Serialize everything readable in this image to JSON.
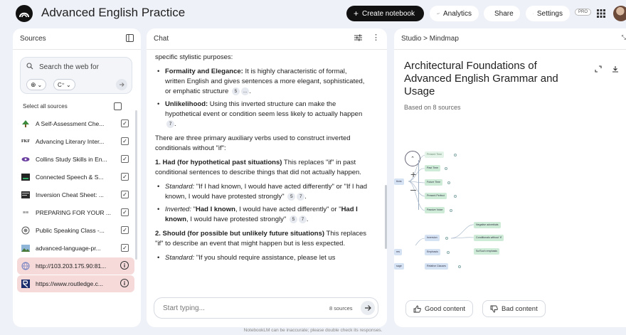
{
  "header": {
    "app_title": "Advanced English Practice",
    "create_label": "Create notebook",
    "analytics_label": "Analytics",
    "share_label": "Share",
    "settings_label": "Settings",
    "pro_label": "PRO"
  },
  "sources": {
    "title": "Sources",
    "search_placeholder": "Search the web for",
    "select_all": "Select all sources",
    "items": [
      {
        "label": "A Self-Assessment Che...",
        "checked": "✓"
      },
      {
        "label": "Advancing Literary Inter...",
        "checked": "✓"
      },
      {
        "label": "Collins Study Skills in En...",
        "checked": "✓"
      },
      {
        "label": "Connected Speech & S...",
        "checked": "✓"
      },
      {
        "label": "Inversion Cheat Sheet: ...",
        "checked": "✓"
      },
      {
        "label": "PREPARING FOR YOUR ...",
        "checked": "✓"
      },
      {
        "label": "Public Speaking Class -...",
        "checked": "✓"
      },
      {
        "label": "advanced-language-pr...",
        "checked": "✓"
      },
      {
        "label": "http://103.203.175.90:81...",
        "error": "i"
      },
      {
        "label": "https://www.routledge.c...",
        "error": "i"
      }
    ],
    "icons": {
      "p2_text": "FKF",
      "p6_text": "≡≡"
    }
  },
  "chat": {
    "title": "Chat",
    "intro_line": "specific stylistic purposes:",
    "b1_bold": "Formality and Elegance:",
    "b1_text": " It is highly characteristic of formal, written English and gives sentences a more elegant, sophisticated, or emphatic structure",
    "b1_c1": "5",
    "b1_c2": "...",
    "b1_end": ".",
    "b2_bold": "Unlikelihood:",
    "b2_text": " Using this inverted structure can make the hypothetical event or condition seem less likely to actually happen",
    "b2_c1": "7",
    "b2_end": ".",
    "p1": "There are three primary auxiliary verbs used to construct inverted conditionals without \"if\":",
    "h1_bold": "1. Had (for hypothetical past situations)",
    "h1_text": " This replaces \"if\" in past conditional sentences to describe things that did not actually happen.",
    "s1_em": "Standard:",
    "s1_text": " \"If I had known, I would have acted differently\" or \"If I had known, I would have protested strongly\"",
    "s1_c1": "5",
    "s1_c2": "7",
    "s1_end": ".",
    "i1_em": "Inverted:",
    "i1_q1": " \"",
    "i1_b1": "Had I known",
    "i1_t1": ", I would have acted differently\" or \"",
    "i1_b2": "Had I known",
    "i1_t2": ", I would have protested strongly\"",
    "i1_c1": "5",
    "i1_c2": "7",
    "i1_end": ".",
    "h2_bold": "2. Should (for possible but unlikely future situations)",
    "h2_text": " This replaces \"if\" to describe an event that might happen but is less expected.",
    "s2_em": "Standard:",
    "s2_text": " \"If you should require assistance, please let us",
    "input_placeholder": "Start typing...",
    "source_count": "8 sources"
  },
  "studio": {
    "breadcrumb": "Studio > Mindmap",
    "title": "Architectural Foundations of Advanced English Grammar and Usage",
    "subtitle": "Based on 8 sources",
    "nodes": {
      "n1": "Present Time",
      "n2": "Past Time",
      "n3": "Future Time",
      "n4": "Present Perfect",
      "n5": "Passive Voice",
      "n6": "Negative adverbials",
      "n7": "Inversion",
      "n8": "Conditionals without 'if'",
      "n9": "Emphasis",
      "n10": "So/Such emphasis",
      "n11": "Relative Clauses",
      "l1": "tions",
      "l2": "res",
      "l3": "sage"
    },
    "good_label": "Good content",
    "bad_label": "Bad content"
  },
  "footer": {
    "disclaimer": "NotebookLM can be inaccurate; please double check its responses."
  }
}
